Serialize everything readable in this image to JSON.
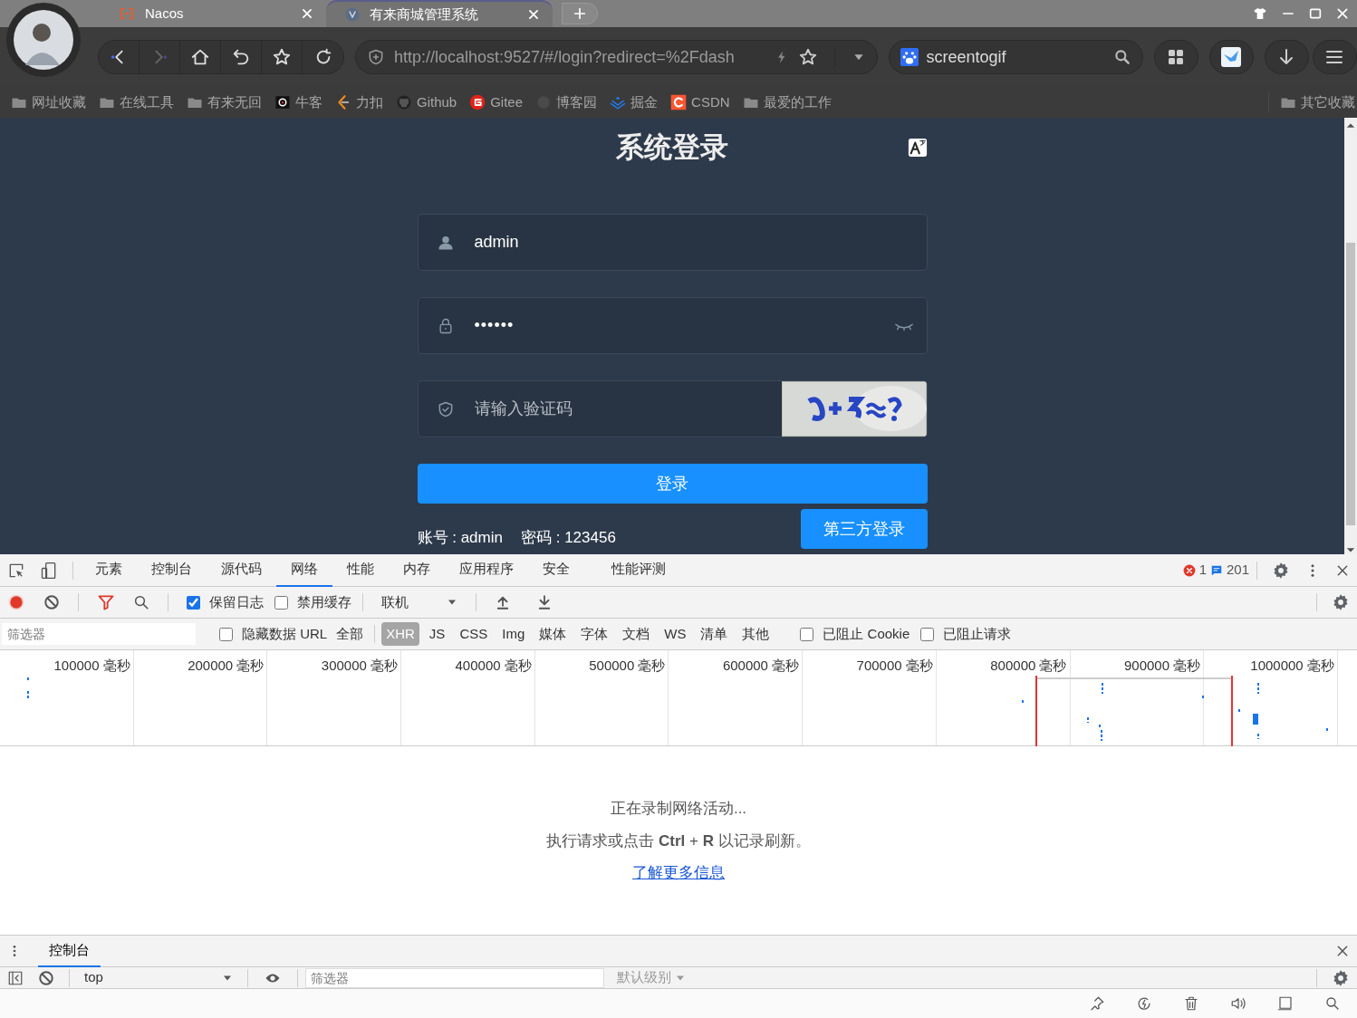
{
  "browser": {
    "tabs": [
      {
        "title": "Nacos",
        "selected": false
      },
      {
        "title": "有来商城管理系统",
        "selected": true
      }
    ],
    "address": "http://localhost:9527/#/login?redirect=%2Fdash",
    "search": "screentogif",
    "bookmarks": [
      {
        "label": "网址收藏",
        "kind": "folder"
      },
      {
        "label": "在线工具",
        "kind": "folder"
      },
      {
        "label": "有来无回",
        "kind": "folder"
      },
      {
        "label": "牛客",
        "kind": "niuke"
      },
      {
        "label": "力扣",
        "kind": "leetcode"
      },
      {
        "label": "Github",
        "kind": "github"
      },
      {
        "label": "Gitee",
        "kind": "gitee"
      },
      {
        "label": "博客园",
        "kind": "blog"
      },
      {
        "label": "掘金",
        "kind": "juejin"
      },
      {
        "label": "CSDN",
        "kind": "csdn"
      },
      {
        "label": "最爱的工作",
        "kind": "folder"
      }
    ],
    "other_bookmarks": "其它收藏"
  },
  "login": {
    "title": "系统登录",
    "username": "admin",
    "password_mask": "••••••",
    "captcha_placeholder": "请输入验证码",
    "login_button": "登录",
    "third_party_button": "第三方登录",
    "account_hint": "账号 : admin",
    "password_hint": "密码 : 123456"
  },
  "devtools": {
    "tabs": [
      {
        "label": "元素",
        "selected": false
      },
      {
        "label": "控制台",
        "selected": false
      },
      {
        "label": "源代码",
        "selected": false
      },
      {
        "label": "网络",
        "selected": true
      },
      {
        "label": "性能",
        "selected": false
      },
      {
        "label": "内存",
        "selected": false
      },
      {
        "label": "应用程序",
        "selected": false
      },
      {
        "label": "安全",
        "selected": false
      },
      {
        "label": "性能评测",
        "selected": false
      }
    ],
    "error_count": "1",
    "message_count": "201",
    "recording": true,
    "preserve_log": {
      "label": "保留日志",
      "checked": true
    },
    "disable_cache": {
      "label": "禁用缓存",
      "checked": false
    },
    "throttling": "联机",
    "filter_placeholder": "筛选器",
    "hide_data_urls": {
      "label": "隐藏数据 URL",
      "checked": false
    },
    "type_filters": [
      {
        "label": "全部",
        "selected": false
      },
      {
        "label": "XHR",
        "selected": true
      },
      {
        "label": "JS",
        "selected": false
      },
      {
        "label": "CSS",
        "selected": false
      },
      {
        "label": "Img",
        "selected": false
      },
      {
        "label": "媒体",
        "selected": false
      },
      {
        "label": "字体",
        "selected": false
      },
      {
        "label": "文档",
        "selected": false
      },
      {
        "label": "WS",
        "selected": false
      },
      {
        "label": "清单",
        "selected": false
      },
      {
        "label": "其他",
        "selected": false
      }
    ],
    "blocked_cookies": {
      "label": "已阻止 Cookie",
      "checked": false
    },
    "blocked_requests": {
      "label": "已阻止请求",
      "checked": false
    },
    "timeline_ticks": [
      "100000 毫秒",
      "200000 毫秒",
      "300000 毫秒",
      "400000 毫秒",
      "500000 毫秒",
      "600000 毫秒",
      "700000 毫秒",
      "800000 毫秒",
      "900000 毫秒",
      "1000000 毫秒"
    ],
    "empty_title": "正在录制网络活动...",
    "empty_hint": "执行请求或点击 **Ctrl** + **R** 以记录刷新。",
    "learn_more": "了解更多信息"
  },
  "drawer": {
    "tab": "控制台",
    "context": "top",
    "filter_placeholder": "筛选器",
    "level": "默认级别"
  }
}
